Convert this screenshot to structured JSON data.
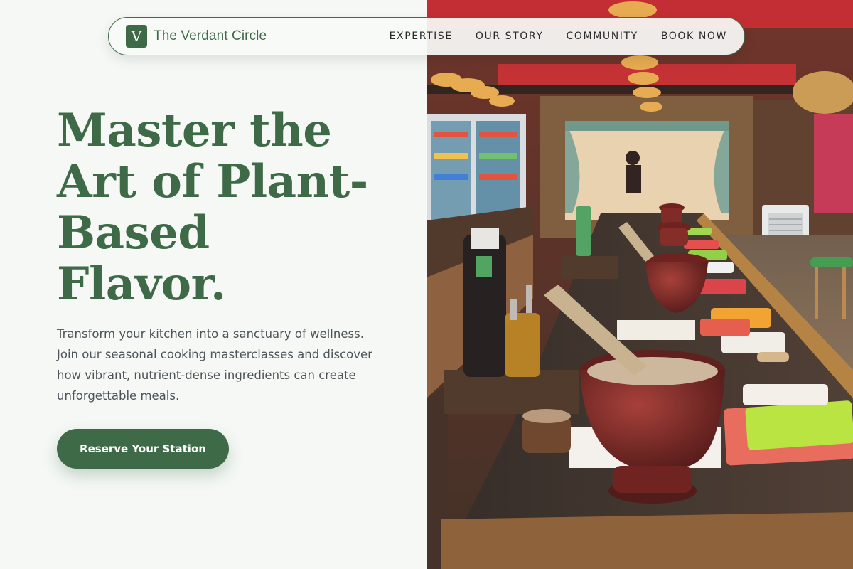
{
  "brand": {
    "logo_letter": "V",
    "name": "The Verdant Circle",
    "accent_color": "#3e6a47"
  },
  "nav": {
    "items": [
      {
        "label": "EXPERTISE"
      },
      {
        "label": "OUR STORY"
      },
      {
        "label": "COMMUNITY"
      },
      {
        "label": "BOOK NOW"
      }
    ]
  },
  "hero": {
    "headline_lines": [
      "Master the",
      "Art of Plant-",
      "Based",
      "Flavor."
    ],
    "subtitle": "Transform your kitchen into a sanctuary of wellness. Join our seasonal cooking masterclasses and discover how vibrant, nutrient-dense ingredients can create unforgettable meals.",
    "cta_label": "Reserve Your Station",
    "image_alt": "Cooking class counter with mortar and pestle stations"
  }
}
